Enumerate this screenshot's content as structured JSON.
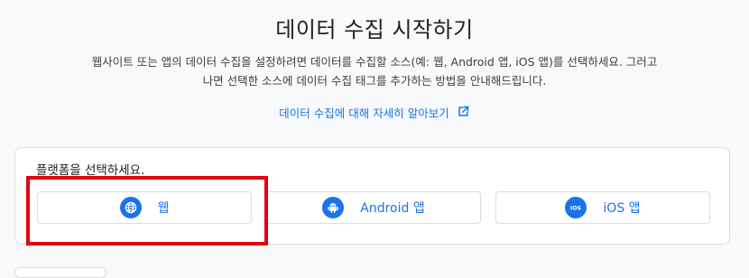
{
  "page": {
    "title": "데이터 수집 시작하기",
    "description_line1": "웹사이트 또는 앱의 데이터 수집을 설정하려면 데이터를 수집할 소스(예: 웹, Android 앱, iOS 앱)를 선택하세요. 그러고",
    "description_line2": "나면 선택한 소스에 데이터 수집 태그를 추가하는 방법을 안내해드립니다.",
    "learn_more_link": "데이터 수집에 대해 자세히 알아보기",
    "learn_more_icon": "open-in-new-icon"
  },
  "platform_card": {
    "label": "플랫폼을 선택하세요.",
    "options": [
      {
        "label": "웹",
        "icon": "globe-icon"
      },
      {
        "label": "Android 앱",
        "icon": "android-icon"
      },
      {
        "label": "iOS 앱",
        "icon": "ios-icon",
        "icon_text": "iOS"
      }
    ]
  },
  "colors": {
    "accent": "#1a73e8",
    "highlight": "#e3000f",
    "background": "#f8f9fa",
    "border": "#dadce0"
  }
}
